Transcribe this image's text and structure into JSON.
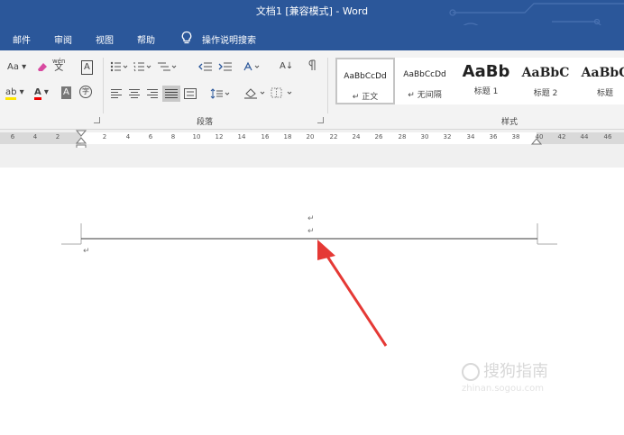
{
  "window": {
    "title": "文档1 [兼容模式] - Word"
  },
  "menu": {
    "items": [
      "邮件",
      "审阅",
      "视图",
      "帮助"
    ],
    "tell_me": "操作说明搜索"
  },
  "ribbon": {
    "font_case_button": "Aa",
    "phonetic_guide": "wén",
    "phonetic_char": "文",
    "char_border": "A",
    "highlight_letters": "ab",
    "font_color_letter": "A",
    "char_shading": "A",
    "enclosed_char": "字",
    "sort_label": "A↓",
    "paragraph_group": "段落",
    "styles_group": "样式",
    "styles": [
      {
        "preview": "AaBbCcDd",
        "name": "↵ 正文"
      },
      {
        "preview": "AaBbCcDd",
        "name": "↵ 无间隔"
      },
      {
        "preview": "AaBb",
        "name": "标题 1"
      },
      {
        "preview": "AaBbC",
        "name": "标题 2"
      },
      {
        "preview": "AaBbC",
        "name": "标题"
      }
    ]
  },
  "ruler": {
    "ticks": [
      "6",
      "4",
      "2",
      "2",
      "4",
      "6",
      "8",
      "10",
      "12",
      "14",
      "16",
      "18",
      "20",
      "22",
      "24",
      "26",
      "28",
      "30",
      "32",
      "34",
      "36",
      "38",
      "40",
      "42",
      "44",
      "46"
    ]
  },
  "document": {
    "paragraph_mark": "↵"
  },
  "watermark": {
    "text": "搜狗指南",
    "url": "zhinan.sogou.com"
  },
  "colors": {
    "title_bar": "#2b579a",
    "arrow": "#e53935"
  }
}
